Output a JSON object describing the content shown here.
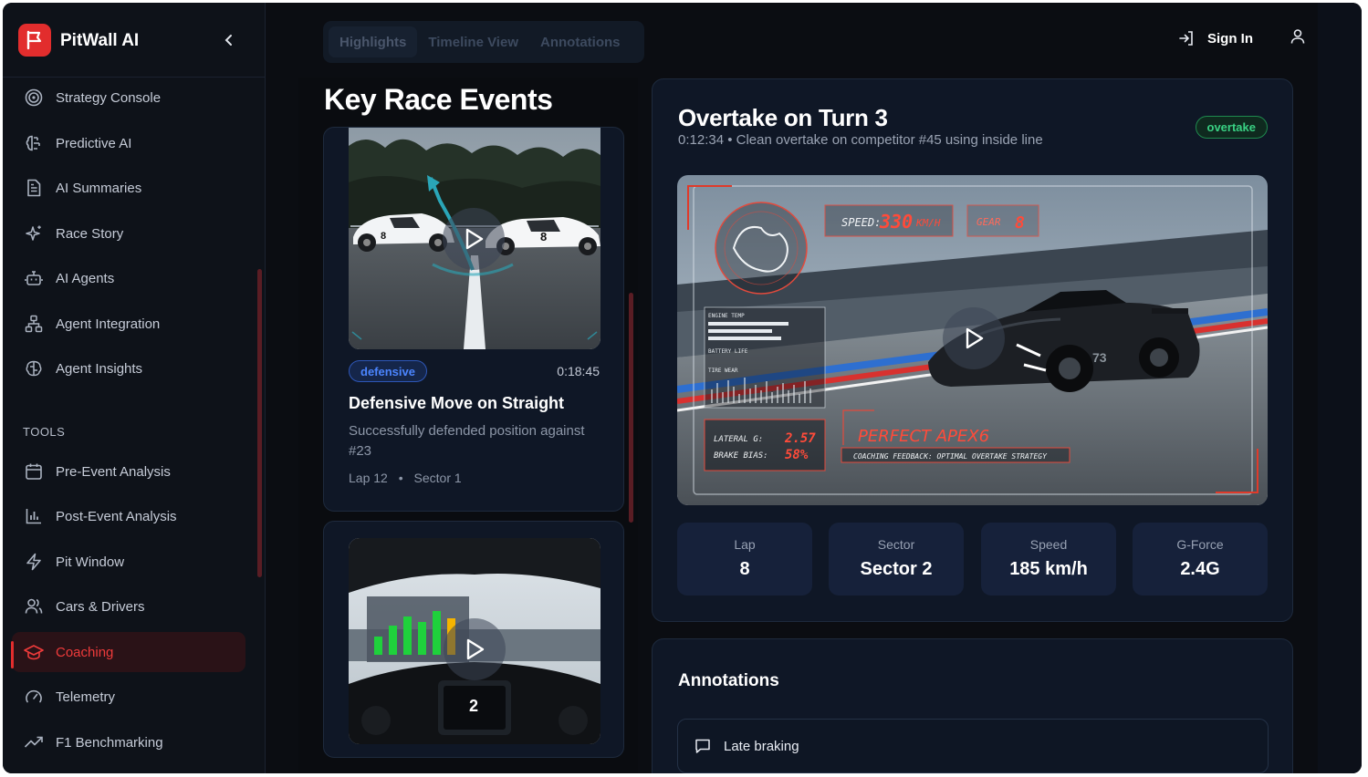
{
  "app": {
    "name": "PitWall AI"
  },
  "sidebar": {
    "items": [
      {
        "label": "Strategy Console",
        "icon": "target-icon"
      },
      {
        "label": "Predictive AI",
        "icon": "brain-icon"
      },
      {
        "label": "AI Summaries",
        "icon": "document-icon"
      },
      {
        "label": "Race Story",
        "icon": "sparkles-icon"
      },
      {
        "label": "AI Agents",
        "icon": "bot-icon"
      },
      {
        "label": "Agent Integration",
        "icon": "network-icon"
      },
      {
        "label": "Agent Insights",
        "icon": "brain-circuit-icon"
      }
    ],
    "tools_label": "TOOLS",
    "tools": [
      {
        "label": "Pre-Event Analysis",
        "icon": "calendar-icon"
      },
      {
        "label": "Post-Event Analysis",
        "icon": "bar-chart-icon"
      },
      {
        "label": "Pit Window",
        "icon": "bolt-icon"
      },
      {
        "label": "Cars & Drivers",
        "icon": "users-icon"
      },
      {
        "label": "Coaching",
        "icon": "graduation-cap-icon",
        "active": true
      },
      {
        "label": "Telemetry",
        "icon": "gauge-icon"
      },
      {
        "label": "F1 Benchmarking",
        "icon": "trending-up-icon"
      }
    ]
  },
  "topbar": {
    "tabs": [
      "Highlights",
      "Timeline View",
      "Annotations"
    ],
    "active_tab": "Highlights",
    "signin_label": "Sign In"
  },
  "events": {
    "title": "Key Race Events",
    "cards": [
      {
        "badge": "defensive",
        "time": "0:18:45",
        "title": "Defensive Move on Straight",
        "description": "Successfully defended position against #23",
        "lap": "Lap 12",
        "sector": "Sector 1"
      },
      {
        "badge": "",
        "time": "",
        "title": "",
        "description": ""
      }
    ]
  },
  "detail": {
    "title": "Overtake on Turn 3",
    "subtitle": "0:12:34 • Clean overtake on competitor #45 using inside line",
    "badge": "overtake",
    "hud": {
      "speed_label": "SPEED:",
      "speed_value": "330",
      "speed_unit": "KM/H",
      "gear_label": "GEAR",
      "gear_value": "8",
      "engine_temp": "ENGINE TEMP",
      "battery_life": "BATTERY LIFE",
      "tire_wear": "TIRE WEAR",
      "lateral_label": "LATERAL G:",
      "lateral_value": "2.57",
      "brake_label": "BRAKE BIAS:",
      "brake_value": "58%",
      "apex_text": "PERFECT APEX6",
      "feedback_text": "COACHING FEEDBACK: OPTIMAL OVERTAKE STRATEGY",
      "car_number": "73"
    },
    "stats": [
      {
        "key": "Lap",
        "value": "8"
      },
      {
        "key": "Sector",
        "value": "Sector 2"
      },
      {
        "key": "Speed",
        "value": "185 km/h"
      },
      {
        "key": "G-Force",
        "value": "2.4G"
      }
    ]
  },
  "annotations": {
    "title": "Annotations",
    "items": [
      {
        "label": "Late braking"
      }
    ]
  },
  "colors": {
    "accent": "#e22d2d",
    "defensive": "#4b85ff",
    "overtake": "#39d083",
    "panel": "#0f1726"
  }
}
